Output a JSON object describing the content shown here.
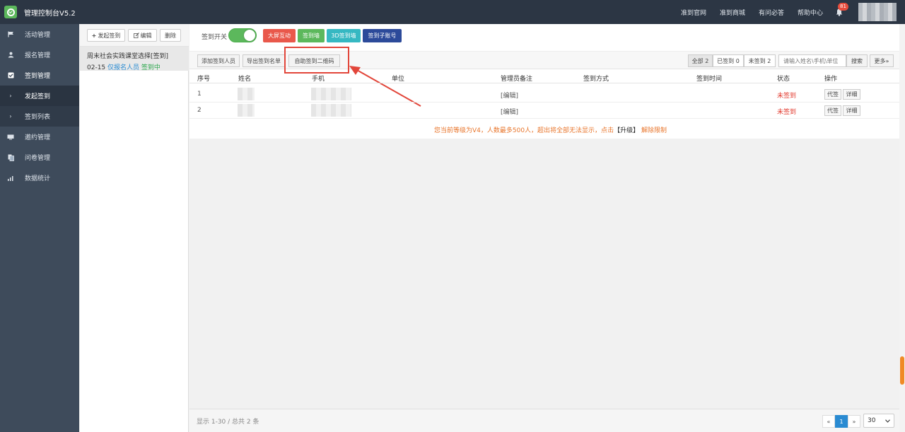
{
  "app": {
    "title": "管理控制台V5.2"
  },
  "topnav": [
    {
      "label": "准到官网"
    },
    {
      "label": "准到商城"
    },
    {
      "label": "有问必答"
    },
    {
      "label": "帮助中心"
    }
  ],
  "notifications": {
    "count": "81"
  },
  "sidebar": {
    "items": [
      {
        "label": "活动管理",
        "icon": "flag-icon"
      },
      {
        "label": "报名管理",
        "icon": "user-icon"
      },
      {
        "label": "签到管理",
        "icon": "checkbox-icon"
      },
      {
        "label": "发起签到",
        "icon": "chevron-right-icon"
      },
      {
        "label": "签到列表",
        "icon": "chevron-right-icon"
      },
      {
        "label": "邀约管理",
        "icon": "invite-icon"
      },
      {
        "label": "问卷管理",
        "icon": "survey-icon"
      },
      {
        "label": "数据统计",
        "icon": "bar-chart-icon"
      }
    ],
    "collapse": "‹"
  },
  "activities": {
    "toolbar": {
      "create": "发起签到",
      "edit": "编辑",
      "delete": "删除"
    },
    "item": {
      "title": "周末社会实践课堂选择[签到]",
      "date": "02-15",
      "scope": "仅报名人员",
      "status": "签到中"
    }
  },
  "main": {
    "toggle_label": "签到开关",
    "top_buttons": {
      "big_screen": "大屏互动",
      "wall": "签到墙",
      "wall3d": "3D签到墙",
      "sub_account": "签到子账号"
    },
    "actions": {
      "add": "添加签到人员",
      "export": "导出签到名单",
      "qrcode": "自助签到二维码"
    },
    "filters": {
      "all": "全部 2",
      "signed": "已签到 0",
      "unsigned": "未签到 2",
      "search_placeholder": "请输入姓名\\手机\\单位",
      "search": "搜索",
      "more": "更多»"
    },
    "table": {
      "headers": {
        "index": "序号",
        "name": "姓名",
        "phone": "手机",
        "unit": "单位",
        "remark": "管理员备注",
        "method": "签到方式",
        "time": "签到时间",
        "status": "状态",
        "ops": "操作"
      },
      "rows": [
        {
          "index": "1",
          "remark": "[编辑]",
          "status": "未签到",
          "proxy": "代签",
          "detail": "详细"
        },
        {
          "index": "2",
          "remark": "[编辑]",
          "status": "未签到",
          "proxy": "代签",
          "detail": "详细"
        }
      ]
    },
    "notice": {
      "text": "您当前等级为V4，人数最多500人，超出将全部无法显示，点击",
      "upgrade": "【升级】",
      "unlock": "解除限制"
    },
    "footer": {
      "summary": "显示 1-30 / 总共 2 条",
      "prev": "«",
      "page": "1",
      "next": "»",
      "page_size": "30"
    }
  },
  "colors": {
    "topbar": "#2c3644",
    "sidebar": "#3e4b5b",
    "big_screen": "#e9584b",
    "wall": "#5cb85c",
    "wall3d": "#36b8c2",
    "sub_account": "#2c4a9a",
    "highlight": "#e2463a"
  }
}
